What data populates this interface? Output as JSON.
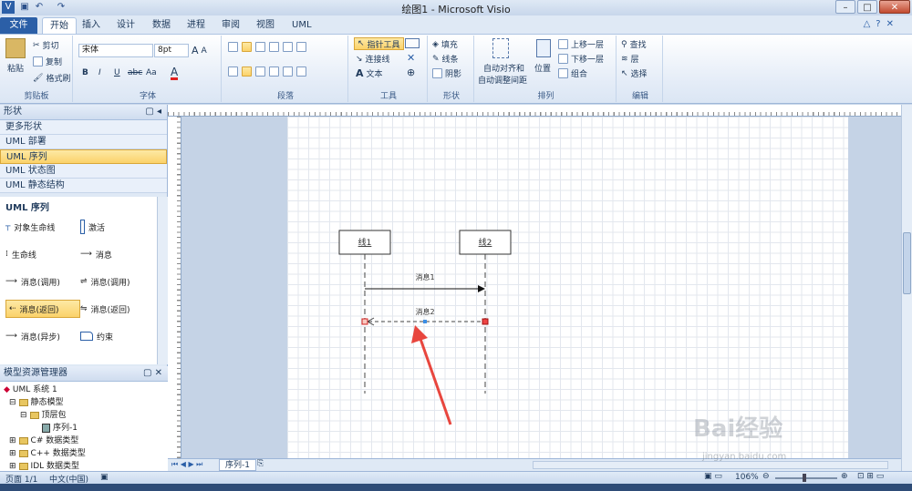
{
  "window": {
    "title": "绘图1 - Microsoft Visio"
  },
  "ribbon_tabs": [
    "文件",
    "开始",
    "插入",
    "设计",
    "数据",
    "进程",
    "审阅",
    "视图",
    "UML"
  ],
  "clipboard": {
    "paste": "粘贴",
    "cut": "剪切",
    "copy": "复制",
    "format_painter": "格式刷",
    "label": "剪贴板"
  },
  "font": {
    "name": "宋体",
    "size": "8pt",
    "label": "字体",
    "bold": "B",
    "italic": "I",
    "underline": "U",
    "strike": "abc",
    "case": "Aa",
    "color": "A"
  },
  "paragraph": {
    "label": "段落"
  },
  "tools": {
    "pointer": "指针工具",
    "connector": "连接线",
    "text": "文本",
    "label": "工具"
  },
  "shape_group": {
    "fill": "填充",
    "line": "线条",
    "shadow": "阴影",
    "label": "形状"
  },
  "arrange": {
    "auto_align": "自动对齐和",
    "auto_space": "自动调整间距",
    "position": "位置",
    "bring_forward": "上移一层",
    "send_backward": "下移一层",
    "group": "组合",
    "label": "排列"
  },
  "editing": {
    "find": "查找",
    "layers": "层",
    "select": "选择",
    "label": "编辑"
  },
  "shapes_pane": {
    "title": "形状",
    "stencils": [
      "更多形状",
      "UML 部署",
      "UML 序列",
      "UML 状态图",
      "UML 静态结构"
    ],
    "selected_stencil": "UML 序列",
    "section_title": "UML 序列",
    "items": [
      [
        "对象生命线",
        "激活"
      ],
      [
        "生命线",
        "消息"
      ],
      [
        "消息(调用)",
        "消息(调用)"
      ],
      [
        "消息(返回)",
        "消息(返回)"
      ],
      [
        "消息(异步)",
        "约束"
      ]
    ]
  },
  "explorer": {
    "title": "模型资源管理器",
    "nodes": [
      "UML 系统 1",
      "静态模型",
      "顶层包",
      "序列-1",
      "C# 数据类型",
      "C++ 数据类型",
      "IDL 数据类型"
    ]
  },
  "diagram": {
    "lifeline1": "线1",
    "lifeline2": "线2",
    "message1": "消息1",
    "message2": "消息2"
  },
  "page_tab": "序列-1",
  "status": {
    "page": "页面 1/1",
    "language": "中文(中国)",
    "zoom": "106%"
  },
  "watermark": {
    "brand": "Bai经验",
    "url": "jingyan.baidu.com"
  },
  "colors": {
    "file_tab": "#2b5fa7",
    "highlight": "#fbd26a",
    "arrow": "#e8463e"
  }
}
